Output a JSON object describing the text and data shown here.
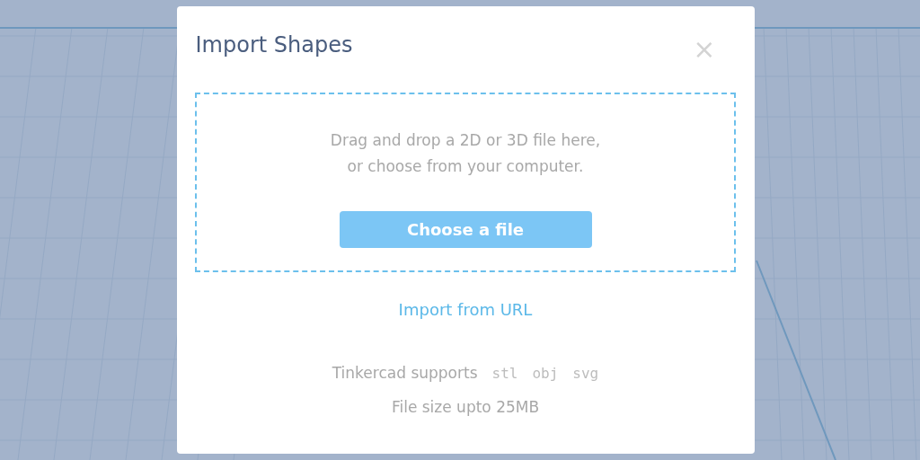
{
  "dialog": {
    "title": "Import Shapes",
    "close": "×"
  },
  "dropzone": {
    "lines": [
      "Drag and drop a 2D or 3D file here,",
      "or choose from your computer."
    ],
    "button": "Choose a file"
  },
  "link": "Import from URL",
  "supports": {
    "label": "Tinkercad supports",
    "formats": [
      "stl",
      "obj",
      "svg"
    ]
  },
  "size_note": "File size upto 25MB"
}
